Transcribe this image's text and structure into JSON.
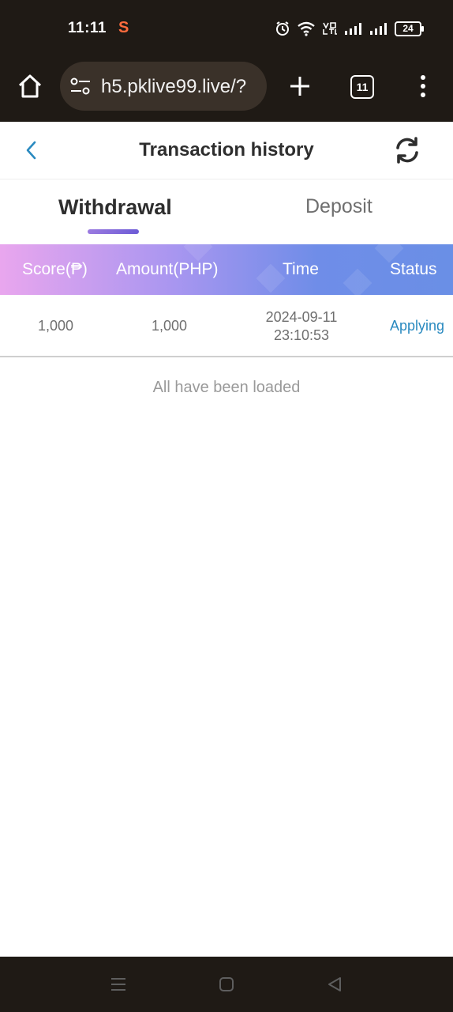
{
  "status_bar": {
    "time": "11:11",
    "app_indicator": "S",
    "battery": "24",
    "icons": [
      "alarm-icon",
      "wifi-icon",
      "volte-icon",
      "signal-icon",
      "signal-icon",
      "battery-icon"
    ]
  },
  "browser": {
    "url": "h5.pklive99.live/?",
    "tab_count": "11"
  },
  "header": {
    "title": "Transaction history"
  },
  "tabs": [
    {
      "label": "Withdrawal",
      "active": true
    },
    {
      "label": "Deposit",
      "active": false
    }
  ],
  "table": {
    "columns": [
      "Score(₱)",
      "Amount(PHP)",
      "Time",
      "Status"
    ],
    "rows": [
      {
        "score": "1,000",
        "amount": "1,000",
        "date": "2024-09-11",
        "time": "23:10:53",
        "status": "Applying"
      }
    ],
    "footer": "All have been loaded"
  },
  "colors": {
    "status_applying": "#2a8ac0",
    "back_arrow": "#2a8ac0",
    "tab_indicator": "#7a64d8"
  }
}
